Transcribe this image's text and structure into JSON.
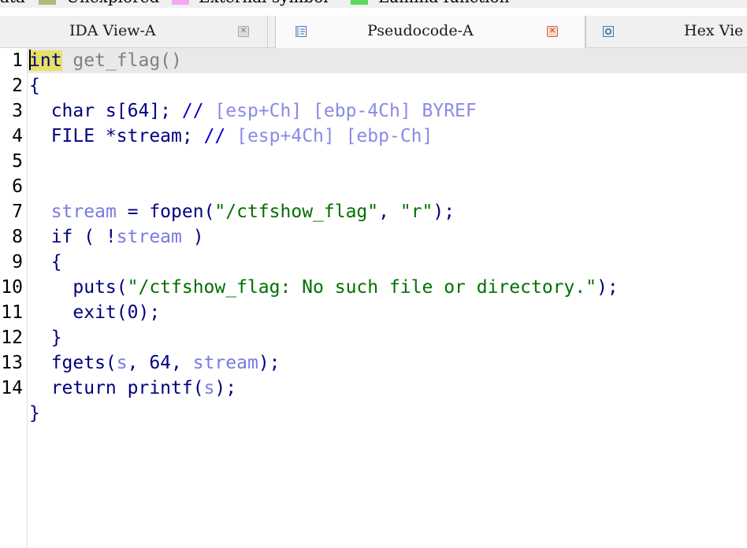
{
  "legend": {
    "items": [
      {
        "label": "ata",
        "color": ""
      },
      {
        "label": "Unexplored",
        "color": "#b5b57a"
      },
      {
        "label": "External symbol",
        "color": "#f4a6f4"
      },
      {
        "label": "Lumina function",
        "color": "#5cd65c"
      }
    ]
  },
  "tabs": [
    {
      "label": "IDA View-A",
      "active": false
    },
    {
      "label": "Pseudocode-A",
      "active": true
    },
    {
      "label": "Hex Vie",
      "active": false
    }
  ],
  "colors": {
    "keyword_highlight": "#e8e066",
    "comment": "#0000c8",
    "string": "#007000",
    "identifier": "#000080",
    "local_var": "#7b7bdf"
  },
  "code": {
    "line_numbers": [
      "1",
      "2",
      "3",
      "4",
      "5",
      "6",
      "7",
      "8",
      "9",
      "10",
      "11",
      "12",
      "13",
      "14"
    ],
    "l1": {
      "kw": "int",
      "sig": " get_flag()"
    },
    "l2": {
      "text": "{"
    },
    "l3": {
      "decl": "  char s[64]; ",
      "comment": "// ",
      "regs": "[esp+Ch] [ebp-4Ch] BYREF"
    },
    "l4": {
      "decl": "  FILE *stream; ",
      "comment": "// ",
      "regs": "[esp+4Ch] [ebp-Ch]"
    },
    "l6": {
      "var": "stream",
      "eq": " = fopen(",
      "s1": "\"/ctfshow_flag\"",
      "sep": ", ",
      "s2": "\"r\"",
      "end": ");"
    },
    "l7": {
      "pre": "  if ( !",
      "var": "stream",
      "post": " )"
    },
    "l8": {
      "text": "  {"
    },
    "l9": {
      "fn": "    puts(",
      "str": "\"/ctfshow_flag: No such file or directory.\"",
      "end": ");"
    },
    "l10": {
      "text": "    exit(0);"
    },
    "l11": {
      "text": "  }"
    },
    "l12": {
      "fn": "  fgets(",
      "v1": "s",
      "mid": ", 64, ",
      "v2": "stream",
      "end": ");"
    },
    "l13": {
      "pre": "  return printf(",
      "v": "s",
      "end": ");"
    },
    "l14": {
      "text": "}"
    }
  }
}
